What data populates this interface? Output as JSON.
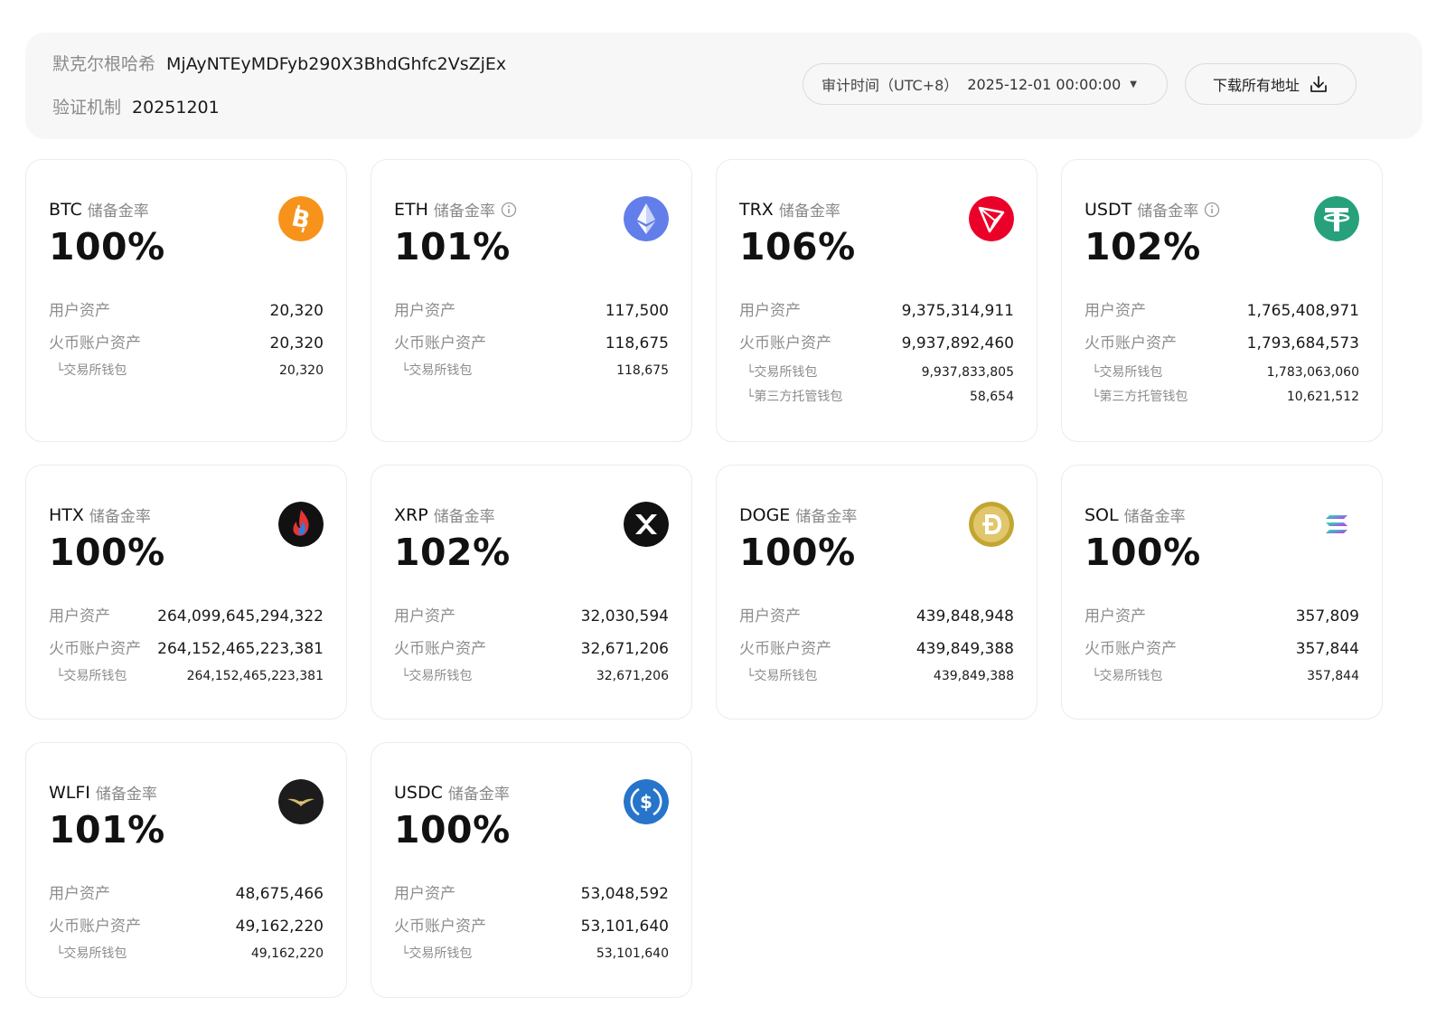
{
  "header": {
    "merkle_label": "默克尔根哈希",
    "merkle_value": "MjAyNTEyMDFyb290X3BhdGhfc2VsZjEx",
    "verify_label": "验证机制",
    "verify_value": "20251201",
    "audit_label": "审计时间（UTC+8）",
    "audit_value": "2025-12-01 00:00:00",
    "download_label": "下载所有地址"
  },
  "labels": {
    "reserve_ratio": "储备金率",
    "user_assets": "用户资产",
    "account_assets": "火币账户资产",
    "exchange_wallet": "└交易所钱包",
    "third_party_wallet": "└第三方托管钱包"
  },
  "cards": [
    {
      "symbol": "BTC",
      "ratio": "100%",
      "user": "20,320",
      "account": "20,320",
      "exchange": "20,320",
      "info": false
    },
    {
      "symbol": "ETH",
      "ratio": "101%",
      "user": "117,500",
      "account": "118,675",
      "exchange": "118,675",
      "info": true
    },
    {
      "symbol": "TRX",
      "ratio": "106%",
      "user": "9,375,314,911",
      "account": "9,937,892,460",
      "exchange": "9,937,833,805",
      "third_party": "58,654",
      "info": false
    },
    {
      "symbol": "USDT",
      "ratio": "102%",
      "user": "1,765,408,971",
      "account": "1,793,684,573",
      "exchange": "1,783,063,060",
      "third_party": "10,621,512",
      "info": true
    },
    {
      "symbol": "HTX",
      "ratio": "100%",
      "user": "264,099,645,294,322",
      "account": "264,152,465,223,381",
      "exchange": "264,152,465,223,381",
      "info": false
    },
    {
      "symbol": "XRP",
      "ratio": "102%",
      "user": "32,030,594",
      "account": "32,671,206",
      "exchange": "32,671,206",
      "info": false
    },
    {
      "symbol": "DOGE",
      "ratio": "100%",
      "user": "439,848,948",
      "account": "439,849,388",
      "exchange": "439,849,388",
      "info": false
    },
    {
      "symbol": "SOL",
      "ratio": "100%",
      "user": "357,809",
      "account": "357,844",
      "exchange": "357,844",
      "info": false
    },
    {
      "symbol": "WLFI",
      "ratio": "101%",
      "user": "48,675,466",
      "account": "49,162,220",
      "exchange": "49,162,220",
      "info": false
    },
    {
      "symbol": "USDC",
      "ratio": "100%",
      "user": "53,048,592",
      "account": "53,101,640",
      "exchange": "53,101,640",
      "info": false
    }
  ],
  "colors": {
    "btc": "#f7931a",
    "eth": "#627eea",
    "trx": "#eb0029",
    "usdt": "#26a17b",
    "usdc": "#2775ca",
    "doge": "#c2a633"
  }
}
